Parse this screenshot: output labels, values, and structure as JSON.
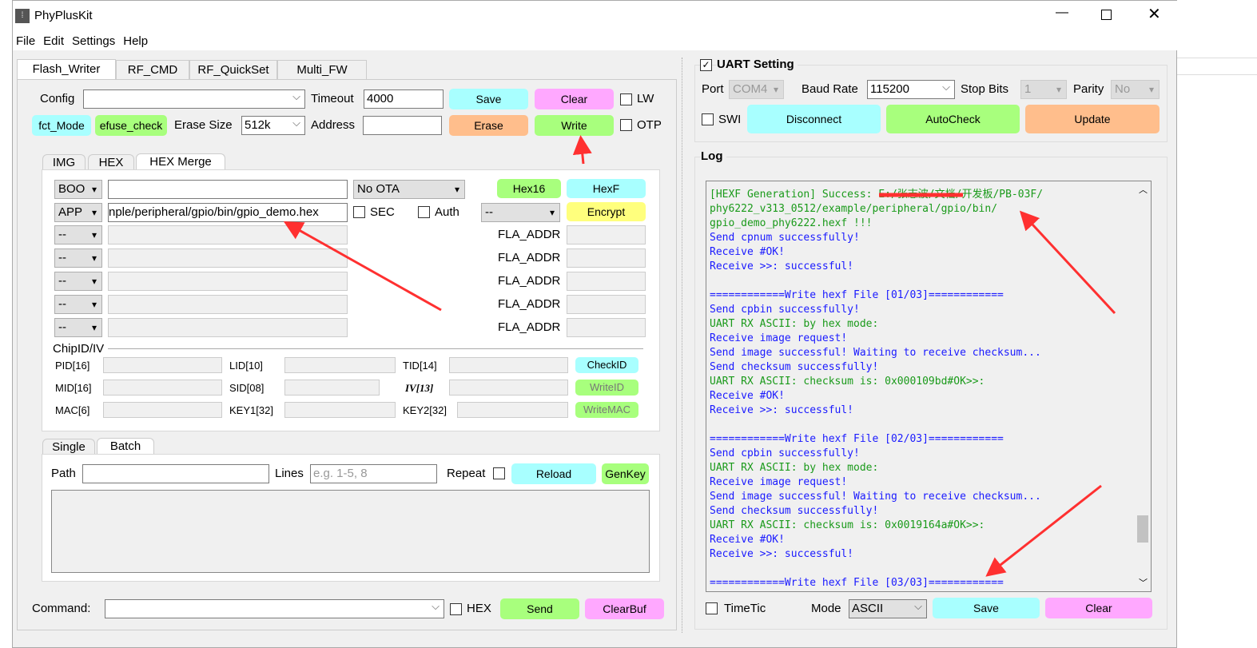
{
  "window": {
    "title": "PhyPlusKit",
    "menu": [
      "File",
      "Edit",
      "Settings",
      "Help"
    ]
  },
  "tabs": [
    "Flash_Writer",
    "RF_CMD",
    "RF_QuickSet",
    "Multi_FW"
  ],
  "config": {
    "config_label": "Config",
    "config_value": "",
    "timeout_label": "Timeout",
    "timeout_value": "4000",
    "save": "Save",
    "clear": "Clear",
    "lw": "LW",
    "fct_mode": "fct_Mode",
    "efuse_check": "efuse_check",
    "erase_size_label": "Erase Size",
    "erase_size_value": "512k",
    "address_label": "Address",
    "address_value": "",
    "erase": "Erase",
    "write": "Write",
    "otp": "OTP"
  },
  "subtabs": [
    "IMG",
    "HEX",
    "HEX Merge"
  ],
  "merge": {
    "row1": {
      "type": "BOO",
      "path": "",
      "ota": "No OTA",
      "hex16": "Hex16",
      "hexf": "HexF"
    },
    "row2": {
      "type": "APP",
      "path": "nple/peripheral/gpio/bin/gpio_demo.hex",
      "sec": "SEC",
      "auth": "Auth",
      "select": "--",
      "encrypt": "Encrypt"
    },
    "rows": [
      {
        "type": "--",
        "addr_label": "FLA_ADDR"
      },
      {
        "type": "--",
        "addr_label": "FLA_ADDR"
      },
      {
        "type": "--",
        "addr_label": "FLA_ADDR"
      },
      {
        "type": "--",
        "addr_label": "FLA_ADDR"
      },
      {
        "type": "--",
        "addr_label": "FLA_ADDR"
      }
    ]
  },
  "chipid": {
    "title": "ChipID/IV",
    "pid": "PID[16]",
    "lid": "LID[10]",
    "tid": "TID[14]",
    "mid": "MID[16]",
    "sid": "SID[08]",
    "iv": "IV[13]",
    "mac": "MAC[6]",
    "key1": "KEY1[32]",
    "key2": "KEY2[32]",
    "checkid": "CheckID",
    "writeid": "WriteID",
    "writemac": "WriteMAC"
  },
  "batch_tabs": [
    "Single",
    "Batch"
  ],
  "batch": {
    "path_label": "Path",
    "lines_label": "Lines",
    "lines_placeholder": "e.g. 1-5, 8",
    "repeat": "Repeat",
    "reload": "Reload",
    "genkey": "GenKey"
  },
  "command": {
    "label": "Command:",
    "value": "",
    "hex": "HEX",
    "send": "Send",
    "clearbuf": "ClearBuf"
  },
  "uart": {
    "title": "UART Setting",
    "checked": true,
    "port_label": "Port",
    "port": "COM4",
    "baud_label": "Baud Rate",
    "baud": "115200",
    "stop_label": "Stop Bits",
    "stop": "1",
    "parity_label": "Parity",
    "parity": "No",
    "swi": "SWI",
    "disconnect": "Disconnect",
    "autocheck": "AutoCheck",
    "update": "Update"
  },
  "log": {
    "title": "Log",
    "lines": [
      {
        "t": "[HEXF Generation] Success: E:/张志波/文档/开发板/PB-03F/",
        "c": "g"
      },
      {
        "t": "phy6222_v313_0512/example/peripheral/gpio/bin/",
        "c": "g"
      },
      {
        "t": "gpio_demo_phy6222.hexf !!!",
        "c": "g"
      },
      {
        "t": "Send cpnum successfully!",
        "c": "b"
      },
      {
        "t": "Receive #OK!",
        "c": "b"
      },
      {
        "t": "Receive >>: successful!",
        "c": "b"
      },
      {
        "t": "",
        "c": "b"
      },
      {
        "t": "============Write hexf File [01/03]============",
        "c": "b"
      },
      {
        "t": "Send cpbin successfully!",
        "c": "b"
      },
      {
        "t": "UART RX ASCII: by hex mode:",
        "c": "g"
      },
      {
        "t": "Receive image request!",
        "c": "b"
      },
      {
        "t": "Send image successful! Waiting to receive checksum...",
        "c": "b"
      },
      {
        "t": "Send checksum successfully!",
        "c": "b"
      },
      {
        "t": "UART RX ASCII: checksum is: 0x000109bd#OK>>:",
        "c": "g"
      },
      {
        "t": "Receive #OK!",
        "c": "b"
      },
      {
        "t": "Receive >>: successful!",
        "c": "b"
      },
      {
        "t": "",
        "c": "b"
      },
      {
        "t": "============Write hexf File [02/03]============",
        "c": "b"
      },
      {
        "t": "Send cpbin successfully!",
        "c": "b"
      },
      {
        "t": "UART RX ASCII: by hex mode:",
        "c": "g"
      },
      {
        "t": "Receive image request!",
        "c": "b"
      },
      {
        "t": "Send image successful! Waiting to receive checksum...",
        "c": "b"
      },
      {
        "t": "Send checksum successfully!",
        "c": "b"
      },
      {
        "t": "UART RX ASCII: checksum is: 0x0019164a#OK>>:",
        "c": "g"
      },
      {
        "t": "Receive #OK!",
        "c": "b"
      },
      {
        "t": "Receive >>: successful!",
        "c": "b"
      },
      {
        "t": "",
        "c": "b"
      },
      {
        "t": "============Write hexf File [03/03]============",
        "c": "b"
      }
    ],
    "timetic": "TimeTic",
    "mode_label": "Mode",
    "mode": "ASCII",
    "save": "Save",
    "clear": "Clear"
  },
  "colors": {
    "log_green": "#1a9a1a",
    "log_blue": "#1a1aff",
    "cyan": "#a8ffff",
    "pink": "#ffa8ff",
    "green": "#a8ff7d",
    "orange": "#ffbe8c",
    "yellow": "#ffff7d",
    "annotation": "#ff3030"
  }
}
